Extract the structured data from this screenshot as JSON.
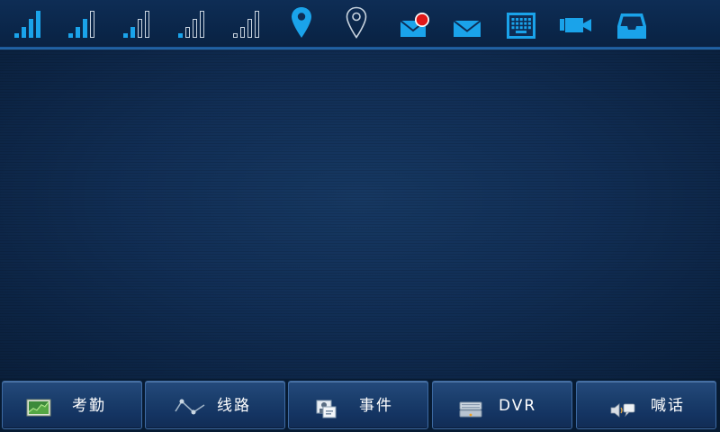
{
  "status_bar": {
    "icons": [
      {
        "name": "signal-4-bars-icon"
      },
      {
        "name": "signal-3-bars-icon"
      },
      {
        "name": "signal-2-bars-icon"
      },
      {
        "name": "signal-1-bar-icon"
      },
      {
        "name": "signal-0-bars-icon"
      },
      {
        "name": "location-pin-active-icon"
      },
      {
        "name": "location-pin-inactive-icon"
      },
      {
        "name": "mail-unread-icon"
      },
      {
        "name": "mail-icon"
      },
      {
        "name": "keyboard-icon"
      },
      {
        "name": "video-camera-icon"
      },
      {
        "name": "storage-tray-icon"
      }
    ]
  },
  "colors": {
    "accent": "#1aa3ea",
    "inactive_icon": "#c9d4df",
    "alert": "#e01818",
    "background": "#0b2340",
    "label": "#ffffff"
  },
  "nav": {
    "items": [
      {
        "label": "考勤",
        "icon": "attendance-chart-icon"
      },
      {
        "label": "线路",
        "icon": "route-line-icon"
      },
      {
        "label": "事件",
        "icon": "event-picture-icon"
      },
      {
        "label": "DVR",
        "icon": "dvr-recorder-icon"
      },
      {
        "label": "喊话",
        "icon": "speaker-intercom-icon"
      }
    ]
  }
}
